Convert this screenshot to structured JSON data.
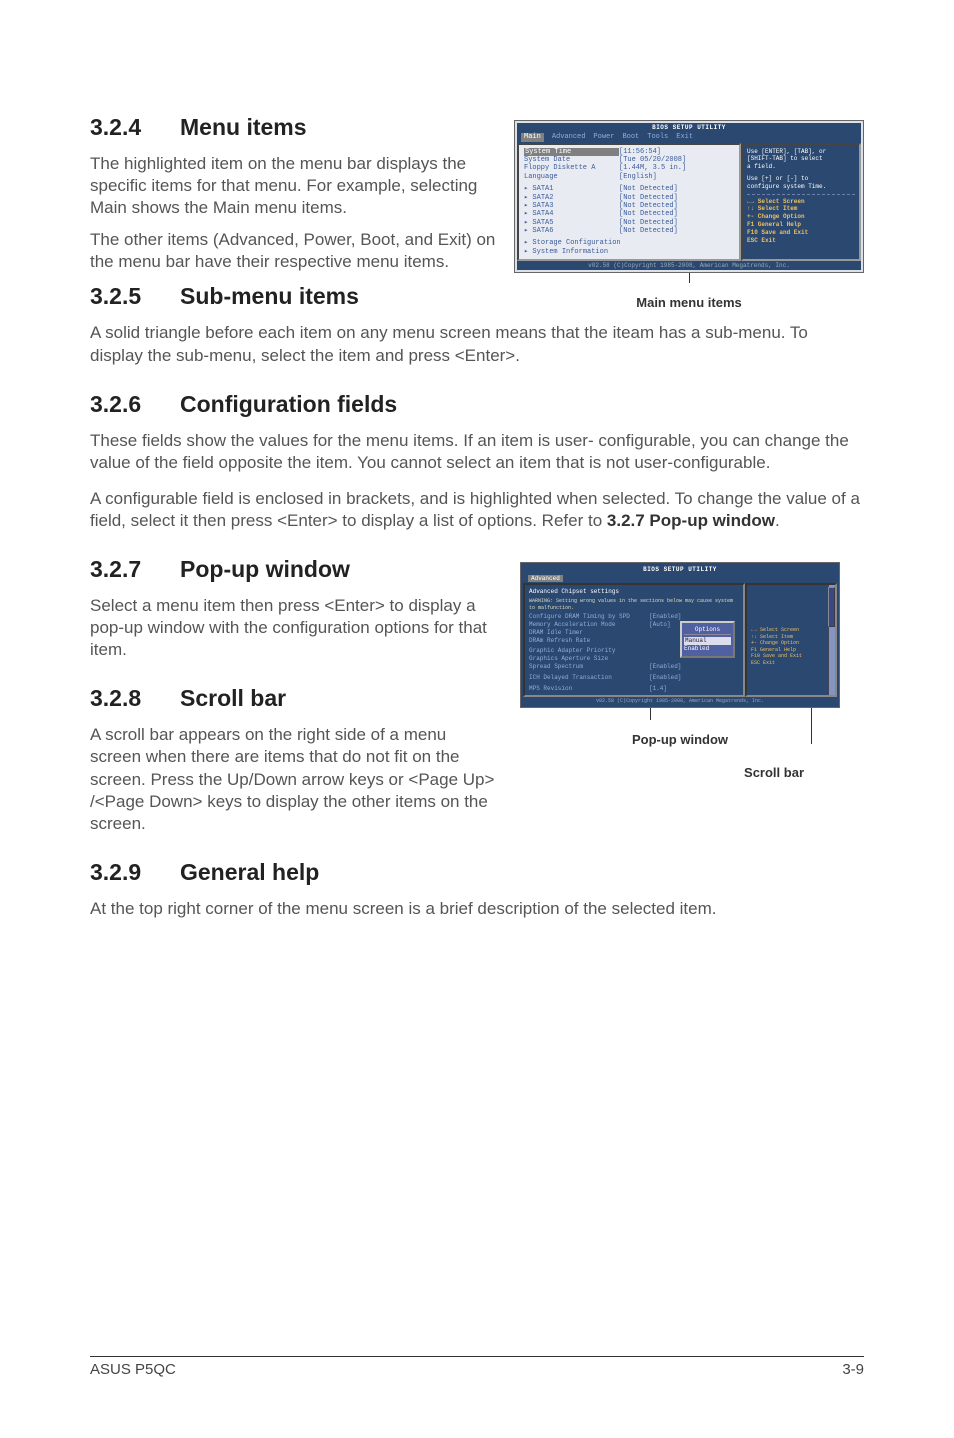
{
  "sections": {
    "s324_num": "3.2.4",
    "s324_title": "Menu items",
    "s324_p1": "The highlighted item on the menu bar displays the specific items for that menu. For example, selecting Main shows the Main menu items.",
    "s324_p2": "The other items (Advanced, Power, Boot, and Exit) on the menu bar have their respective menu items.",
    "s325_num": "3.2.5",
    "s325_title": "Sub-menu items",
    "s325_p1": "A solid triangle before each item on any menu screen means that the iteam has a sub-menu. To display the sub-menu, select the item and press <Enter>.",
    "s326_num": "3.2.6",
    "s326_title": "Configuration fields",
    "s326_p1": "These fields show the values for the menu items. If an item is user- configurable, you can change the value of the field opposite the item. You cannot select an item that is not user-configurable.",
    "s326_p2": "A configurable field is enclosed in brackets, and is highlighted when selected. To change the value of a field, select it then press <Enter> to display a list of options. Refer to ",
    "s326_ref": "3.2.7 Pop-up window",
    "s326_p2_end": ".",
    "s327_num": "3.2.7",
    "s327_title": "Pop-up window",
    "s327_p1": "Select a menu item then press <Enter> to display a pop-up window with the configuration options for that item.",
    "s328_num": "3.2.8",
    "s328_title": "Scroll bar",
    "s328_p1": "A scroll bar appears on the right side of a menu screen when there are items that do not fit on the screen. Press the Up/Down arrow keys or <Page Up> /<Page Down> keys to display the other items on the screen.",
    "s329_num": "3.2.9",
    "s329_title": "General help",
    "s329_p1": "At the top right corner of the menu screen is a brief description of the selected item."
  },
  "fig1": {
    "caption": "Main menu items",
    "header": "BIOS SETUP UTILITY",
    "menubar": [
      "Main",
      "Advanced",
      "Power",
      "Boot",
      "Tools",
      "Exit"
    ],
    "rows": [
      {
        "label": "System Time",
        "value": "[11:56:54]",
        "hl": true
      },
      {
        "label": "System Date",
        "value": "[Tue 05/20/2008]"
      },
      {
        "label": "Floppy Diskette A",
        "value": "[1.44M, 3.5 in.]"
      },
      {
        "label": "Language",
        "value": "[English]"
      }
    ],
    "sata": [
      {
        "label": "SATA1",
        "value": "[Not Detected]"
      },
      {
        "label": "SATA2",
        "value": "[Not Detected]"
      },
      {
        "label": "SATA3",
        "value": "[Not Detected]"
      },
      {
        "label": "SATA4",
        "value": "[Not Detected]"
      },
      {
        "label": "SATA5",
        "value": "[Not Detected]"
      },
      {
        "label": "SATA6",
        "value": "[Not Detected]"
      }
    ],
    "subs": [
      "Storage Configuration",
      "System Information"
    ],
    "help": {
      "line1": "Use [ENTER], [TAB], or",
      "line2": "[SHIFT-TAB] to select",
      "line3": "a field.",
      "line4": "Use [+] or [-] to",
      "line5": "configure system Time.",
      "keys": [
        "←→    Select Screen",
        "↑↓    Select Item",
        "+-    Change Option",
        "F1    General Help",
        "F10   Save and Exit",
        "ESC   Exit"
      ]
    },
    "footer": "v02.58 (C)Copyright 1985-2008, American Megatrends, Inc."
  },
  "fig2": {
    "caption_popup": "Pop-up window",
    "caption_scroll": "Scroll bar",
    "header": "BIOS SETUP UTILITY",
    "tab": "Advanced",
    "title": "Advanced Chipset settings",
    "warning": "WARNING: Setting wrong values in the sections below may cause system to malfunction.",
    "rows": [
      {
        "label": "Configure DRAM Timing by SPD",
        "value": "[Enabled]"
      },
      {
        "label": "Memory Acceleration Mode",
        "value": "[Auto]"
      },
      {
        "label": "DRAM Idle Timer",
        "value": ""
      },
      {
        "label": "DRAm Refresh Rate",
        "value": ""
      },
      {
        "label": "Graphic Adapter Priority",
        "value": ""
      },
      {
        "label": "Graphics Aperture Size",
        "value": ""
      },
      {
        "label": "Spread Spectrum",
        "value": "[Enabled]"
      },
      {
        "label": "ICH Delayed Transaction",
        "value": "[Enabled]"
      },
      {
        "label": "MPS Revision",
        "value": "[1.4]"
      }
    ],
    "popup": {
      "title": "Options",
      "opt1": "Manual",
      "opt2": "Enabled"
    },
    "help_keys": [
      "←→   Select Screen",
      "↑↓   Select Item",
      "+-   Change Option",
      "F1   General Help",
      "F10  Save and Exit",
      "ESC  Exit"
    ],
    "footer": "v02.58 (C)Copyright 1985-2008, American Megatrends, Inc."
  },
  "footer": {
    "left": "ASUS P5QC",
    "right": "3-9"
  }
}
